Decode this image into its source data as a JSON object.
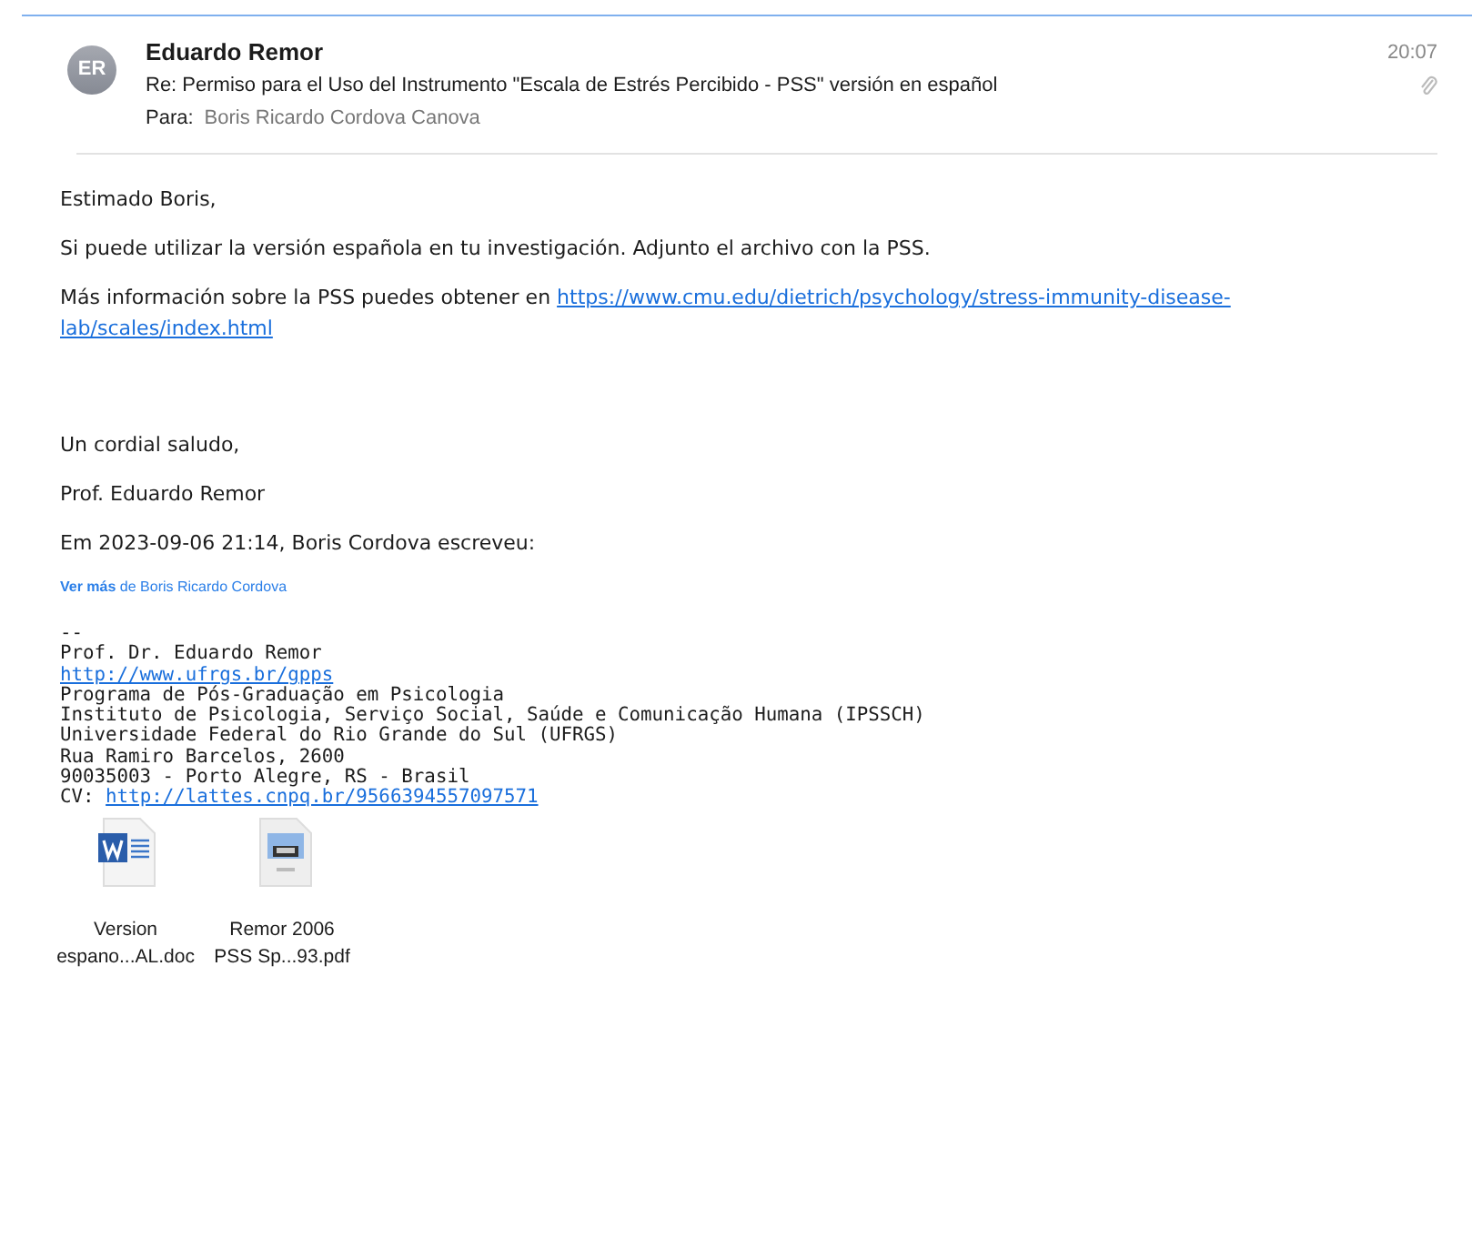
{
  "header": {
    "avatar_initials": "ER",
    "sender": "Eduardo Remor",
    "subject": "Re: Permiso para el Uso del Instrumento \"Escala de Estrés Percibido - PSS\" versión en español",
    "to_label": "Para:",
    "to": "Boris Ricardo Cordova Canova",
    "time": "20:07",
    "has_attachment": true
  },
  "body": [
    {
      "kind": "text",
      "text": "Estimado Boris,"
    },
    {
      "kind": "text",
      "text": "Si puede utilizar la versión española en tu investigación. Adjunto el archivo con la PSS."
    },
    {
      "kind": "link_para",
      "text": "Más información sobre la PSS puedes obtener en",
      "link_lines": [
        "https://www.cmu.edu/dietrich/psychology/stress-immunity-disease-",
        "lab/scales/index.html"
      ]
    },
    {
      "kind": "gap"
    },
    {
      "kind": "text",
      "text": "Un cordial saludo,"
    },
    {
      "kind": "text",
      "text": "Prof. Eduardo Remor"
    }
  ],
  "quote_header": "Em 2023-09-06 21:14, Boris Cordova escreveu:",
  "see_more": "**Ver más** de Boris Ricardo Cordova",
  "signature": [
    {
      "kind": "text",
      "text": "--"
    },
    {
      "kind": "text",
      "text": "Prof. Dr. Eduardo Remor"
    },
    {
      "kind": "link",
      "text": "http://www.ufrgs.br/gpps"
    },
    {
      "kind": "text",
      "text": "Programa de Pós-Graduação em Psicologia"
    },
    {
      "kind": "text",
      "text": "Instituto de Psicologia, Serviço Social, Saúde e Comunicação Humana (IPSSCH)"
    },
    {
      "kind": "text",
      "text": "Universidade Federal do Rio Grande do Sul (UFRGS)"
    },
    {
      "kind": "text",
      "text": "Rua Ramiro Barcelos, 2600"
    },
    {
      "kind": "text",
      "text": "90035003 - Porto Alegre, RS - Brasil"
    },
    {
      "kind": "cv",
      "label": "CV:",
      "link": "http://lattes.cnpq.br/9566394557097571"
    }
  ],
  "attachments": [
    {
      "kind": "doc",
      "name_line_1": "Version",
      "name_line_2": "espano...AL.doc"
    },
    {
      "kind": "pdf",
      "name_line_1": "Remor 2006",
      "name_line_2": "PSS Sp...93.pdf"
    }
  ]
}
